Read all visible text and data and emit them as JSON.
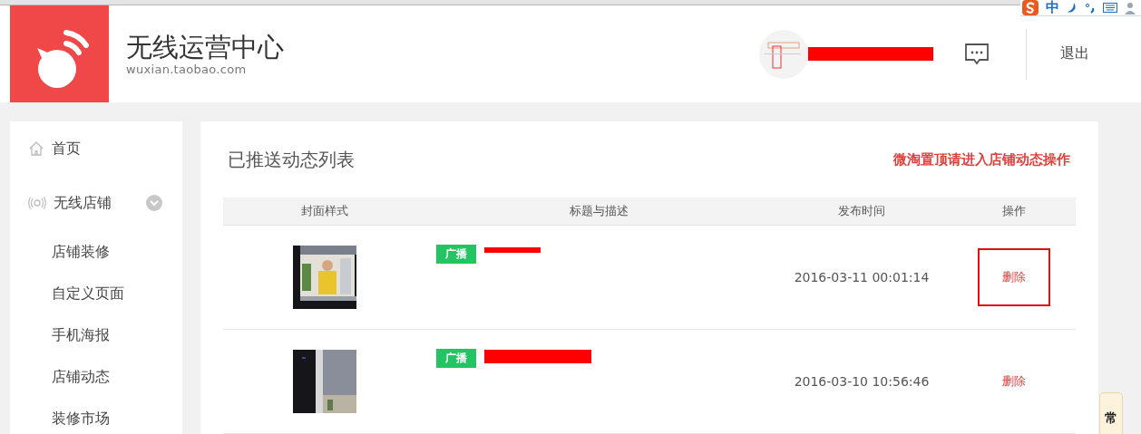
{
  "header": {
    "brand_title": "无线运营中心",
    "brand_domain": "wuxian.taobao.com",
    "logout": "退出"
  },
  "ime_bar": {
    "mode": "中"
  },
  "sidebar": {
    "items": [
      {
        "label": "首页",
        "kind": "home"
      },
      {
        "label": "无线店铺",
        "kind": "signal",
        "expanded": true,
        "children": [
          {
            "label": "店铺装修"
          },
          {
            "label": "自定义页面"
          },
          {
            "label": "手机海报"
          },
          {
            "label": "店铺动态"
          },
          {
            "label": "装修市场"
          }
        ]
      }
    ]
  },
  "main": {
    "title": "已推送动态列表",
    "notice": "微淘置顶请进入店铺动态操作",
    "table": {
      "columns": [
        "封面样式",
        "标题与描述",
        "发布时间",
        "操作"
      ],
      "rows": [
        {
          "tag": "广播",
          "published": "2016-03-11 00:01:14",
          "action": "删除",
          "highlighted": true
        },
        {
          "tag": "广播",
          "published": "2016-03-10 10:56:46",
          "action": "删除",
          "highlighted": false
        }
      ]
    }
  },
  "float_tab": {
    "label": "常"
  }
}
